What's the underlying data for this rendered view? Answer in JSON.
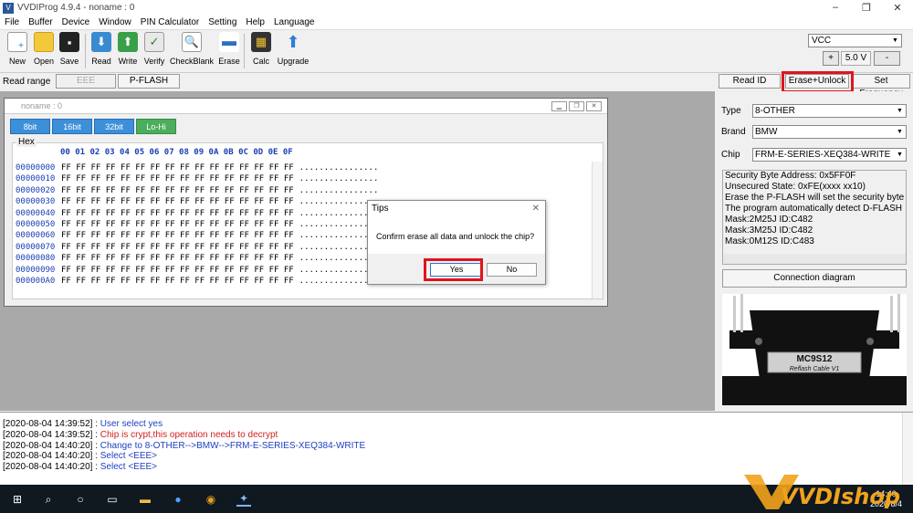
{
  "window": {
    "title": "VVDIProg 4.9.4 - noname : 0",
    "min": "–",
    "max": "❐",
    "close": "✕"
  },
  "menu": [
    "File",
    "Buffer",
    "Device",
    "Window",
    "PIN Calculator",
    "Setting",
    "Help",
    "Language"
  ],
  "toolbar": {
    "items": [
      {
        "label": "New",
        "icon": "new-file-icon"
      },
      {
        "label": "Open",
        "icon": "folder-icon"
      },
      {
        "label": "Save",
        "icon": "floppy-icon"
      },
      {
        "label": "Read",
        "icon": "read-chip-icon"
      },
      {
        "label": "Write",
        "icon": "write-chip-icon"
      },
      {
        "label": "Verify",
        "icon": "verify-icon"
      },
      {
        "label": "CheckBlank",
        "icon": "check-blank-icon"
      },
      {
        "label": "Erase",
        "icon": "erase-icon"
      },
      {
        "label": "Calc",
        "icon": "calculator-icon"
      },
      {
        "label": "Upgrade",
        "icon": "upgrade-arrow-icon"
      }
    ]
  },
  "power": {
    "vcc": "VCC",
    "plus": "+",
    "voltage": "5.0 V",
    "minus": "-"
  },
  "readrange": {
    "label": "Read range",
    "eee": "EEE",
    "pflash": "P-FLASH"
  },
  "actions": {
    "read_id": "Read ID",
    "erase_unlock": "Erase+Unlock",
    "set_freq": "Set Frequency"
  },
  "hexwindow": {
    "title": "noname : 0",
    "tabs": [
      "8bit",
      "16bit",
      "32bit",
      "Lo-Hi"
    ],
    "group_label": "Hex",
    "header": "00 01 02 03 04 05 06 07 08 09 0A 0B 0C 0D 0E 0F",
    "rows": [
      {
        "addr": "00000000",
        "bytes": "FF FF FF FF FF FF FF FF FF FF FF FF FF FF FF FF",
        "ascii": "................"
      },
      {
        "addr": "00000010",
        "bytes": "FF FF FF FF FF FF FF FF FF FF FF FF FF FF FF FF",
        "ascii": "................"
      },
      {
        "addr": "00000020",
        "bytes": "FF FF FF FF FF FF FF FF FF FF FF FF FF FF FF FF",
        "ascii": "................"
      },
      {
        "addr": "00000030",
        "bytes": "FF FF FF FF FF FF FF FF FF FF FF FF FF FF FF FF",
        "ascii": "................"
      },
      {
        "addr": "00000040",
        "bytes": "FF FF FF FF FF FF FF FF FF FF FF FF FF FF FF FF",
        "ascii": "................"
      },
      {
        "addr": "00000050",
        "bytes": "FF FF FF FF FF FF FF FF FF FF FF FF FF FF FF FF",
        "ascii": "................"
      },
      {
        "addr": "00000060",
        "bytes": "FF FF FF FF FF FF FF FF FF FF FF FF FF FF FF FF",
        "ascii": "................"
      },
      {
        "addr": "00000070",
        "bytes": "FF FF FF FF FF FF FF FF FF FF FF FF FF FF FF FF",
        "ascii": "................"
      },
      {
        "addr": "00000080",
        "bytes": "FF FF FF FF FF FF FF FF FF FF FF FF FF FF FF FF",
        "ascii": "................"
      },
      {
        "addr": "00000090",
        "bytes": "FF FF FF FF FF FF FF FF FF FF FF FF FF FF FF FF",
        "ascii": "................"
      },
      {
        "addr": "000000A0",
        "bytes": "FF FF FF FF FF FF FF FF FF FF FF FF FF FF FF FF",
        "ascii": "................"
      }
    ]
  },
  "dialog": {
    "title": "Tips",
    "message": "Confirm erase all data and unlock the chip?",
    "yes": "Yes",
    "no": "No"
  },
  "chip": {
    "type_label": "Type",
    "type_value": "8-OTHER",
    "brand_label": "Brand",
    "brand_value": "BMW",
    "chip_label": "Chip",
    "chip_value": "FRM-E-SERIES-XEQ384-WRITE"
  },
  "info": [
    "Security Byte Address: 0x5FF0F",
    "Unsecured State: 0xFE(xxxx xx10)",
    "Erase the P-FLASH will set the security byte",
    "The program automatically detect D-FLASH",
    "Mask:2M25J ID:C482",
    "Mask:3M25J ID:C482",
    "Mask:0M12S ID:C483"
  ],
  "connection_button": "Connection diagram",
  "cable": {
    "text1": "MC9S12",
    "text2": "Reflash Cable V1"
  },
  "log": [
    {
      "time": "[2020-08-04 14:39:52]",
      "msg": "User select yes",
      "color": "#1f3fbf"
    },
    {
      "time": "[2020-08-04 14:39:52]",
      "msg": "Chip is crypt,this operation needs to decrypt",
      "color": "#d02020"
    },
    {
      "time": "[2020-08-04 14:40:20]",
      "msg": "Change to 8-OTHER-->BMW-->FRM-E-SERIES-XEQ384-WRITE",
      "color": "#1f3fbf"
    },
    {
      "time": "[2020-08-04 14:40:20]",
      "msg": "Select <EEE>",
      "color": "#1f3fbf"
    },
    {
      "time": "[2020-08-04 14:40:20]",
      "msg": "Select <EEE>",
      "color": "#1f3fbf"
    }
  ],
  "taskbar": {
    "clock_time": "14:40",
    "clock_date": "2020/8/4"
  },
  "watermark": "VVDIshop"
}
